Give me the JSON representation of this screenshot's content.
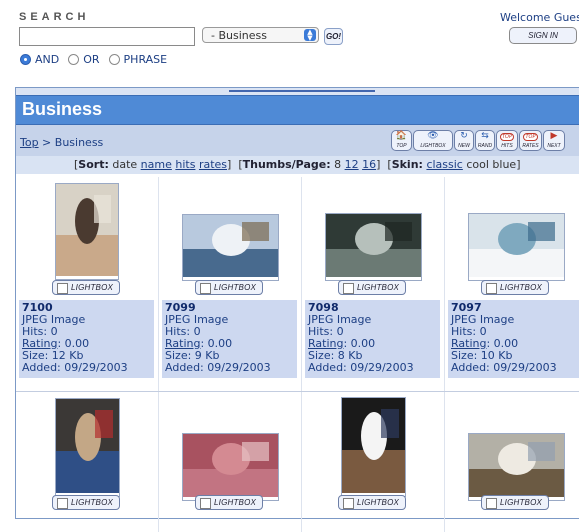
{
  "search": {
    "title": "SEARCH",
    "input_value": "",
    "category_selected": "- Business",
    "go_label": "GO!",
    "modes": [
      {
        "label": "AND",
        "checked": true
      },
      {
        "label": "OR",
        "checked": false
      },
      {
        "label": "PHRASE",
        "checked": false
      }
    ]
  },
  "user": {
    "welcome_text": "Welcome Gues",
    "sign_in_label": "SIGN IN"
  },
  "category": {
    "title": "Business",
    "breadcrumb_top": "Top",
    "breadcrumb_sep": " > ",
    "breadcrumb_current": "Business"
  },
  "toolbar": {
    "top": "TOP",
    "lightbox": "LIGHTBOX",
    "new": "NEW",
    "rand": "RAND",
    "hits": "HITS",
    "rates": "RATES",
    "next": "NEXT",
    "top_badge": "TOP"
  },
  "sort_bar": {
    "sort_label": "Sort:",
    "sort_current": "date",
    "sort_links": [
      "name",
      "hits",
      "rates"
    ],
    "thumbs_label": "Thumbs/Page:",
    "thumbs_current": "8",
    "thumbs_links": [
      "12",
      "16"
    ],
    "skin_label": "Skin:",
    "skin_link": "classic",
    "skin_current": "cool blue"
  },
  "lightbox_label": "LIGHTBOX",
  "images": [
    {
      "id": "7100",
      "type": "JPEG Image",
      "hits": "Hits: 0",
      "rating_label": "Rating",
      "rating_value": ": 0.00",
      "size": "Size: 12 Kb",
      "added": "Added: 09/29/2003",
      "colors": [
        "#d8d2c6",
        "#4a3a30",
        "#c9a98a",
        "#e9e4da"
      ]
    },
    {
      "id": "7099",
      "type": "JPEG Image",
      "hits": "Hits: 0",
      "rating_label": "Rating",
      "rating_value": ": 0.00",
      "size": "Size: 9 Kb",
      "added": "Added: 09/29/2003",
      "colors": [
        "#b8c9de",
        "#eef2f6",
        "#486a8e",
        "#7b6a50"
      ]
    },
    {
      "id": "7098",
      "type": "JPEG Image",
      "hits": "Hits: 0",
      "rating_label": "Rating",
      "rating_value": ": 0.00",
      "size": "Size: 8 Kb",
      "added": "Added: 09/29/2003",
      "colors": [
        "#2f3a36",
        "#b6c0bb",
        "#6b7a74",
        "#1e2622"
      ]
    },
    {
      "id": "7097",
      "type": "JPEG Image",
      "hits": "Hits: 0",
      "rating_label": "Rating",
      "rating_value": ": 0.00",
      "size": "Size: 10 Kb",
      "added": "Added: 09/29/2003",
      "colors": [
        "#d9e3ea",
        "#7fa9bf",
        "#f4f6f8",
        "#3c6b8c"
      ]
    },
    {
      "id": "",
      "colors": [
        "#3b3836",
        "#c3a786",
        "#2f4f86",
        "#b32d2d"
      ]
    },
    {
      "id": "",
      "colors": [
        "#a85260",
        "#d48a92",
        "#c27482",
        "#e7c3c6"
      ]
    },
    {
      "id": "",
      "colors": [
        "#1a1a1a",
        "#f4f4f4",
        "#7a5a40",
        "#2d3a5e"
      ]
    },
    {
      "id": "",
      "colors": [
        "#b3b0a6",
        "#eeeae2",
        "#6b5a43",
        "#93a0b0"
      ]
    }
  ]
}
